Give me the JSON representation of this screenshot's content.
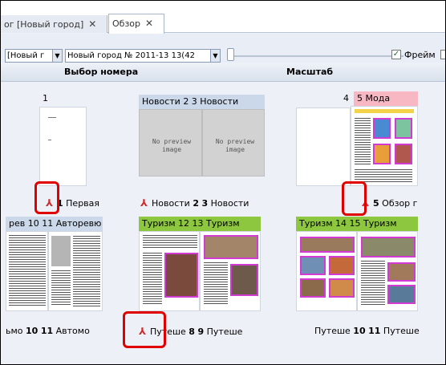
{
  "tabs": [
    {
      "label": "ог [Новый город]"
    },
    {
      "label": "Обзор"
    }
  ],
  "tab_close": "✕",
  "toolbar": {
    "issue_select": "[Новый г",
    "edition_select": "Новый город № 2011-13 13(42",
    "dropdown_arrow": "▼",
    "checkbox_mark": "✓",
    "frames_label": "Фрейм"
  },
  "header": {
    "left": "Выбор номера",
    "right": "Масштаб"
  },
  "spreads": {
    "s1": {
      "top": "1",
      "caption_num": "1",
      "caption_text": "Первая"
    },
    "s2": {
      "top": "Новости   2  3  Новости",
      "caption_a": "Новости",
      "num_a": "2",
      "num_b": "3",
      "caption_b": "Новости",
      "nopreview": "No preview image"
    },
    "s3": {
      "top_num": "4",
      "top_tag_num": "5",
      "top_tag": "Мода",
      "caption_num": "5",
      "caption_text": "Обзор г"
    },
    "s4": {
      "top": "рев  10  11  Авторевю",
      "caption_a": "ьмо",
      "num_a": "10",
      "num_b": "11",
      "caption_b": "Автомо"
    },
    "s5": {
      "top": "Туризм   12  13  Туризм",
      "caption_a": "Путеше",
      "num_a": "8",
      "num_b": "9",
      "caption_b": "Путеше"
    },
    "s6": {
      "top": "Туризм   14  15  Туризм",
      "caption_a": "Путеше",
      "num_a": "10",
      "num_b": "11",
      "caption_b": "Путеше"
    }
  },
  "pdf_icon": "⅄",
  "colors": {
    "accent_green": "#8dc63f",
    "accent_pink": "#f7b8c4",
    "highlight": "#e00000",
    "spread_blue": "#cbd8ea"
  }
}
